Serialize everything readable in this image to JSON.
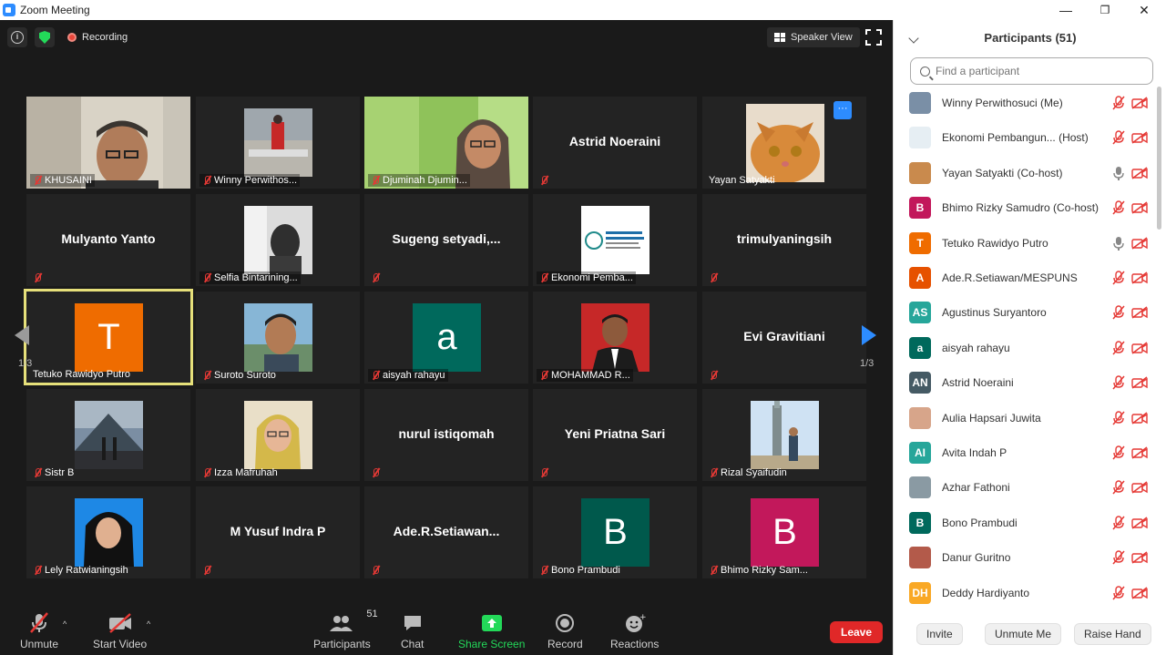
{
  "window": {
    "title": "Zoom Meeting",
    "minimize": "—",
    "restore": "❐",
    "close": "✕"
  },
  "topbar": {
    "recording_label": "Recording",
    "speaker_view_label": "Speaker View"
  },
  "pagination": {
    "left": "1/3",
    "right": "1/3"
  },
  "tiles": {
    "khusaini": "KHUSAINI",
    "winny": "Winny Perwithos...",
    "djuminah": "Djuminah Djumin...",
    "astrid": "Astrid Noeraini",
    "yayan": "Yayan Satyakti",
    "mulyanto": "Mulyanto Yanto",
    "selfia": "Selfia Bintarining...",
    "sugeng": "Sugeng  setyadi,...",
    "ekonomi": "Ekonomi Pemba...",
    "trimulyaningsih": "trimulyaningsih",
    "tetuko": "Tetuko Rawidyo Putro",
    "tetuko_letter": "T",
    "suroto": "Suroto Suroto",
    "aisyah": "aisyah rahayu",
    "aisyah_letter": "a",
    "mohammad": "MOHAMMAD R...",
    "evi": "Evi Gravitiani",
    "sistr": "Sistr B",
    "izza": "Izza Mafruhah",
    "nurul": "nurul istiqomah",
    "yeni": "Yeni Priatna Sari",
    "rizal": "Rizal Syaifudin",
    "lely": "Lely Ratwianingsih",
    "yusuf": "M Yusuf Indra P",
    "ade": "Ade.R.Setiawan...",
    "bono": "Bono Prambudi",
    "bono_letter": "B",
    "bhimo": "Bhimo Rizky Sam...",
    "bhimo_letter": "B",
    "more": "···"
  },
  "toolbar": {
    "unmute": "Unmute",
    "start_video": "Start Video",
    "participants": "Participants",
    "participants_count": "51",
    "chat": "Chat",
    "share_screen": "Share Screen",
    "record": "Record",
    "reactions": "Reactions",
    "leave": "Leave"
  },
  "panel": {
    "header": "Participants (51)",
    "search_placeholder": "Find a participant",
    "participants": [
      {
        "name": "Winny Perwithosuci (Me)",
        "avatar": "",
        "color": "#7a8fa6"
      },
      {
        "name": "Ekonomi Pembangun... (Host)",
        "avatar": "",
        "color": "#e6eef3"
      },
      {
        "name": "Yayan Satyakti (Co-host)",
        "avatar": "",
        "color": "#c98a4d"
      },
      {
        "name": "Bhimo Rizky Samudro (Co-host)",
        "avatar": "B",
        "color": "#c2185b"
      },
      {
        "name": "Tetuko Rawidyo Putro",
        "avatar": "T",
        "color": "#ef6c00"
      },
      {
        "name": "Ade.R.Setiawan/MESPUNS",
        "avatar": "A",
        "color": "#e65100"
      },
      {
        "name": "Agustinus Suryantoro",
        "avatar": "AS",
        "color": "#26a69a"
      },
      {
        "name": "aisyah rahayu",
        "avatar": "a",
        "color": "#00695c"
      },
      {
        "name": "Astrid Noeraini",
        "avatar": "AN",
        "color": "#455a64"
      },
      {
        "name": "Aulia Hapsari Juwita",
        "avatar": "",
        "color": "#d7a58a"
      },
      {
        "name": "Avita Indah P",
        "avatar": "AI",
        "color": "#26a69a"
      },
      {
        "name": "Azhar Fathoni",
        "avatar": "",
        "color": "#8a9aa3"
      },
      {
        "name": "Bono Prambudi",
        "avatar": "B",
        "color": "#00695c"
      },
      {
        "name": "Danur Guritno",
        "avatar": "",
        "color": "#b35a4a"
      },
      {
        "name": "Deddy Hardiyanto",
        "avatar": "DH",
        "color": "#f9a825"
      }
    ],
    "invite": "Invite",
    "unmute_me": "Unmute Me",
    "raise_hand": "Raise Hand"
  }
}
